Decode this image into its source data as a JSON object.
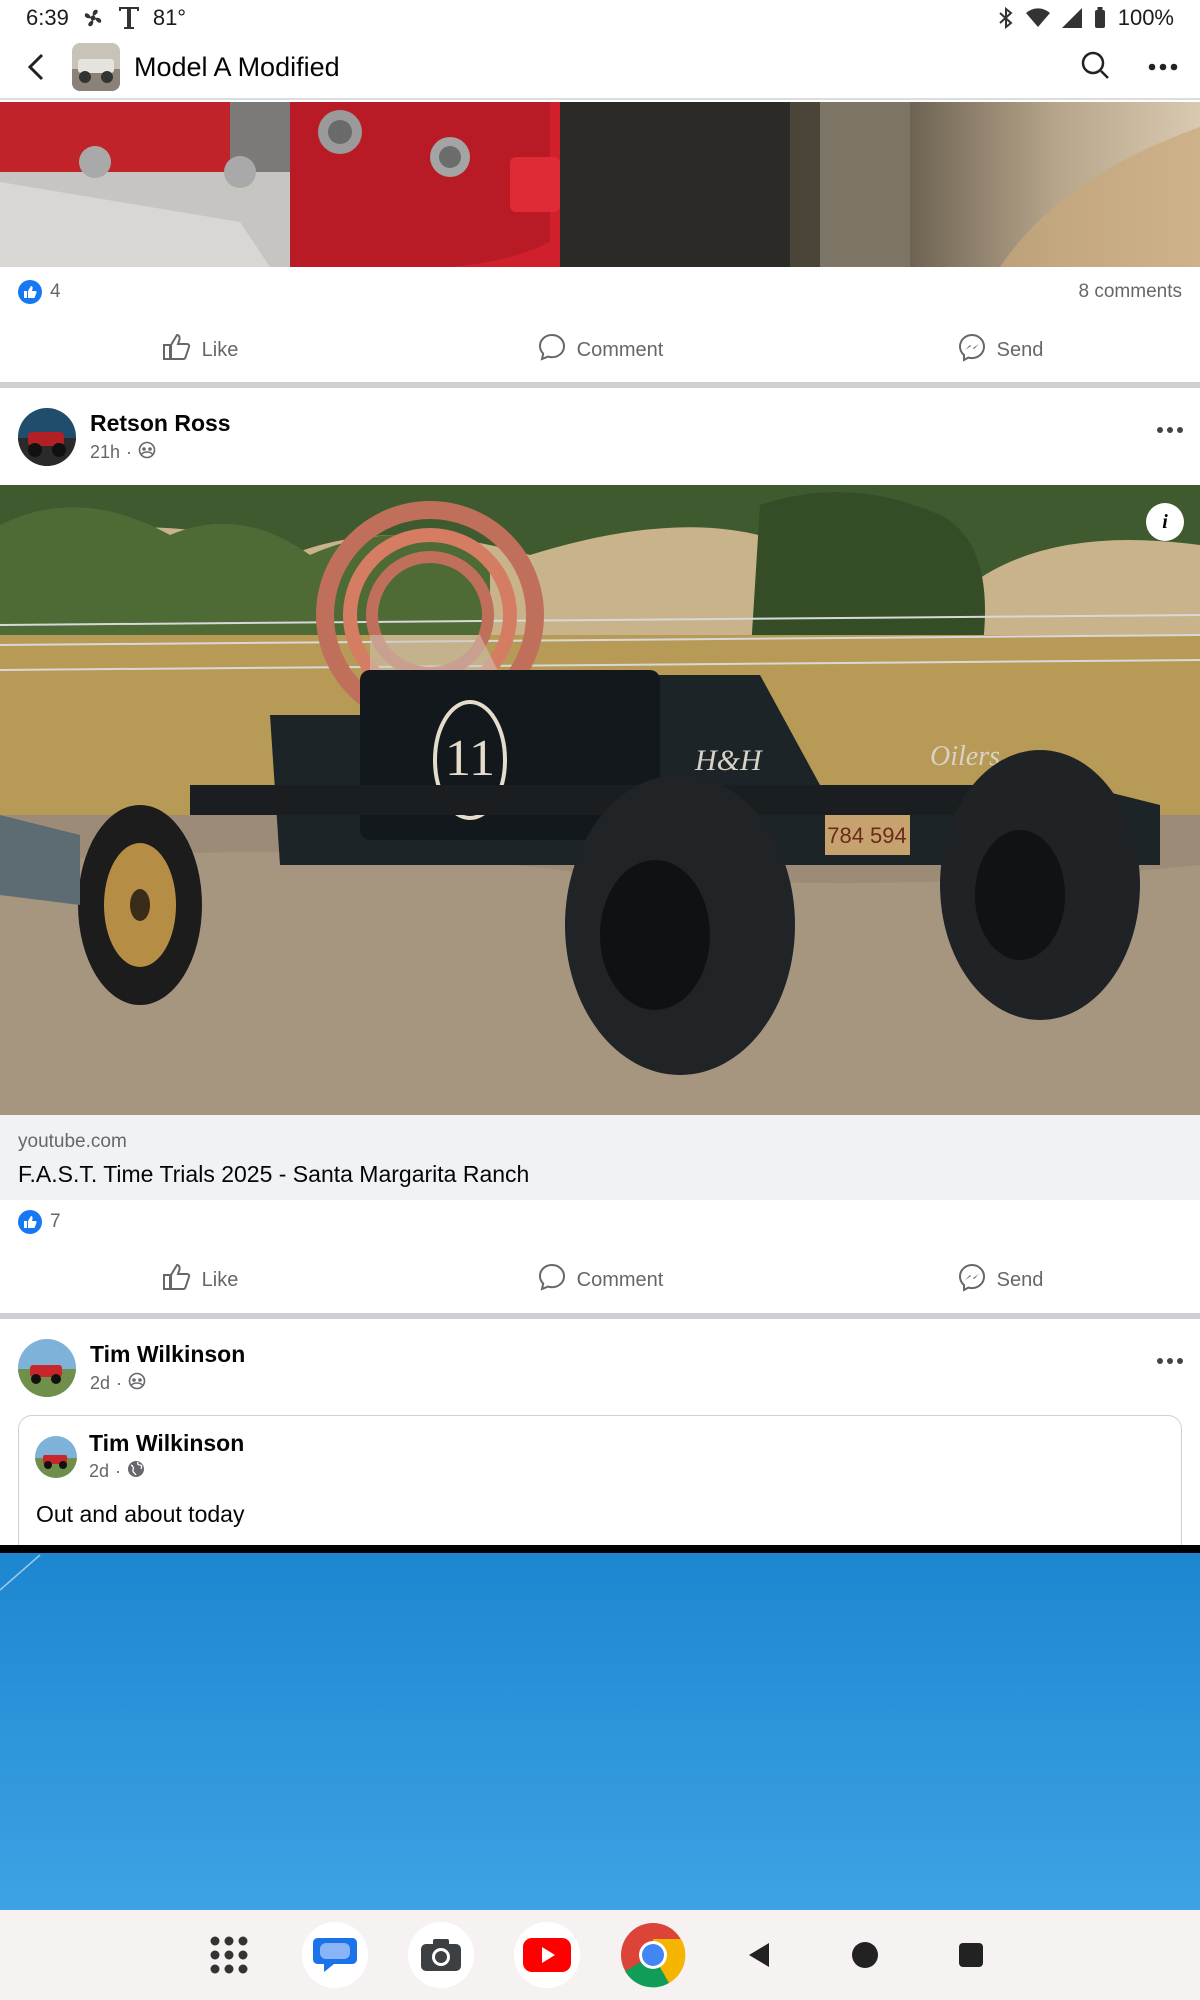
{
  "status_bar": {
    "time": "6:39",
    "temperature": "81°",
    "battery": "100%"
  },
  "group_header": {
    "title": "Model A Modified",
    "icons": [
      "back-arrow-icon",
      "search-icon",
      "more-icon"
    ]
  },
  "post1": {
    "like_count": "4",
    "comments_label": "8 comments",
    "actions": {
      "like": "Like",
      "comment": "Comment",
      "send": "Send"
    }
  },
  "post2": {
    "author": "Retson Ross",
    "time": "21h",
    "privacy_icon": "group-icon",
    "link_domain": "youtube.com",
    "link_title": "F.A.S.T. Time Trials 2025 - Santa Margarita Ranch",
    "like_count": "7",
    "actions": {
      "like": "Like",
      "comment": "Comment",
      "send": "Send"
    }
  },
  "post3": {
    "author": "Tim Wilkinson",
    "time": "2d",
    "privacy_icon": "group-icon",
    "shared": {
      "author": "Tim Wilkinson",
      "time": "2d",
      "privacy_icon": "globe-icon",
      "text": "Out and about today"
    }
  },
  "colors": {
    "accent": "#1877f2",
    "separator": "#ced0d4",
    "secondary_text": "#65676b",
    "sky": "#2f95d8"
  },
  "nav_bar": {
    "apps": [
      "app-drawer-icon",
      "messages-icon",
      "camera-icon",
      "youtube-icon",
      "chrome-icon"
    ],
    "system": [
      "back-nav-icon",
      "home-nav-icon",
      "recents-nav-icon"
    ]
  }
}
